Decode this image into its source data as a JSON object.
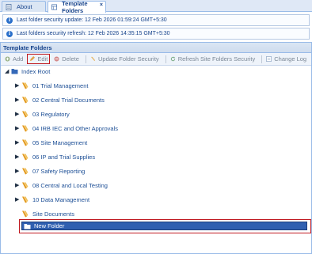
{
  "tabs": [
    {
      "label": "About",
      "icon": "document-icon"
    },
    {
      "label": "Template Folders",
      "icon": "folder-grid-icon",
      "active": true,
      "close": "×"
    }
  ],
  "info": {
    "update": "Last folder security update: 12 Feb 2026 01:59:24 GMT+5:30",
    "refresh": "Last folders security refresh: 12 Feb 2026 14:35:15 GMT+5:30"
  },
  "panel": {
    "title": "Template Folders"
  },
  "toolbar": {
    "add": "Add",
    "edit": "Edit",
    "delete": "Delete",
    "update_security": "Update Folder Security",
    "refresh_security": "Refresh Site Folders Security",
    "change_log": "Change Log"
  },
  "tree": {
    "root": "Index Root",
    "items": [
      "01 Trial Management",
      "02 Central Trial Documents",
      "03 Regulatory",
      "04 IRB IEC and Other Approvals",
      "05 Site Management",
      "06 IP and Trial Supplies",
      "07 Safety Reporting",
      "08 Central and Local Testing",
      "10 Data Management"
    ],
    "site_documents": "Site Documents",
    "new_folder": "New Folder"
  },
  "colors": {
    "accent": "#2f5fb0",
    "highlight_border": "#c0181f",
    "secured_icon": "#e39a1e",
    "text": "#1d4f96"
  }
}
